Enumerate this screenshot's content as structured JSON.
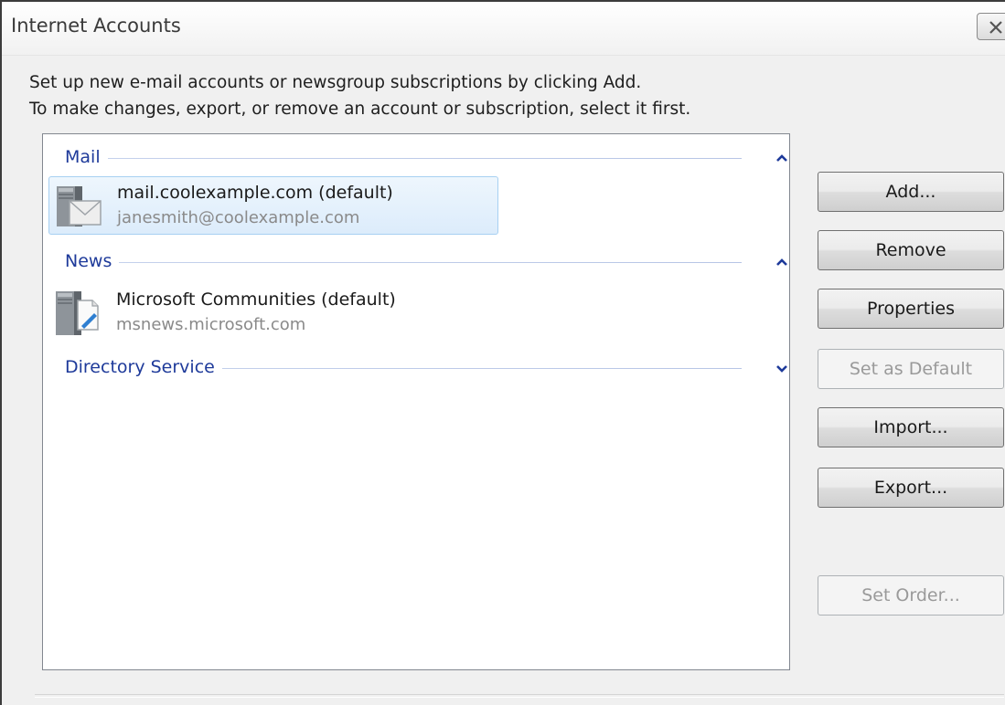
{
  "window": {
    "title": "Internet Accounts"
  },
  "intro": {
    "line1": "Set up new e-mail accounts or newsgroup subscriptions by clicking Add.",
    "line2": "To make changes, export, or remove an account or subscription, select it first."
  },
  "groups": {
    "mail": {
      "label": "Mail",
      "expanded": true,
      "items": [
        {
          "name": "mail.coolexample.com (default)",
          "detail": "janesmith@coolexample.com",
          "selected": true,
          "icon": "mail-server-icon"
        }
      ]
    },
    "news": {
      "label": "News",
      "expanded": true,
      "items": [
        {
          "name": "Microsoft Communities (default)",
          "detail": "msnews.microsoft.com",
          "selected": false,
          "icon": "news-server-icon"
        }
      ]
    },
    "directory": {
      "label": "Directory Service",
      "expanded": false
    }
  },
  "buttons": {
    "add": "Add...",
    "remove": "Remove",
    "properties": "Properties",
    "set_default": "Set as Default",
    "import": "Import...",
    "export": "Export...",
    "set_order": "Set Order..."
  },
  "colors": {
    "group_label": "#1e3a9a",
    "selection_bg": "#dcecfb",
    "selection_border": "#a7d0f2"
  }
}
